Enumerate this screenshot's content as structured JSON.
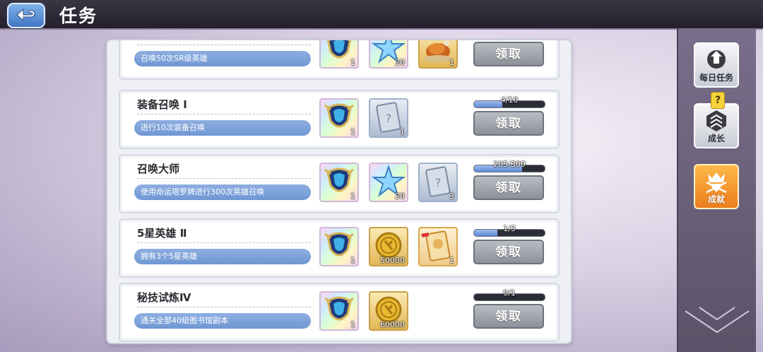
{
  "header": {
    "title": "任务"
  },
  "side_nav": [
    {
      "label": "每日任务",
      "icon": "daily-task-icon",
      "active": false
    },
    {
      "label": "成长",
      "icon": "growth-icon",
      "active": false,
      "badge": "?"
    },
    {
      "label": "成就",
      "icon": "achievement-icon",
      "active": true
    }
  ],
  "tasks": [
    {
      "name": "",
      "description": "召唤50次SR级英雄",
      "progress_text": "",
      "progress": null,
      "rewards": [
        {
          "icon": "hero-crest-icon",
          "count": "1"
        },
        {
          "icon": "summon-star-icon",
          "count": "20"
        },
        {
          "icon": "roast-chicken-icon",
          "count": "1"
        }
      ],
      "button": "领取"
    },
    {
      "name": "装备召唤 Ⅰ",
      "description": "进行10次装备召唤",
      "progress_text": "4/10",
      "progress": 0.4,
      "rewards": [
        {
          "icon": "hero-crest-icon",
          "count": "1"
        },
        {
          "icon": "mystery-card-icon",
          "count": "1"
        }
      ],
      "button": "领取"
    },
    {
      "name": "召唤大师",
      "description": "使用命运塔罗牌进行300次英雄召唤",
      "progress_text": "205/300",
      "progress": 0.683,
      "rewards": [
        {
          "icon": "hero-crest-icon",
          "count": "1"
        },
        {
          "icon": "summon-star-icon",
          "count": "20"
        },
        {
          "icon": "mystery-card-icon",
          "count": "3"
        }
      ],
      "button": "领取"
    },
    {
      "name": "5星英雄 Ⅱ",
      "description": "拥有3个5星英雄",
      "progress_text": "1/3",
      "progress": 0.333,
      "rewards": [
        {
          "icon": "hero-crest-icon",
          "count": "1"
        },
        {
          "icon": "gold-coin-icon",
          "count": "50000"
        },
        {
          "icon": "hero-card-icon",
          "count": "1"
        }
      ],
      "button": "领取"
    },
    {
      "name": "秘技试炼Ⅳ",
      "description": "通关全部40级图书馆副本",
      "progress_text": "0/1",
      "progress": 0,
      "rewards": [
        {
          "icon": "hero-crest-icon",
          "count": "1"
        },
        {
          "icon": "gold-coin-icon",
          "count": "60000"
        }
      ],
      "button": "领取"
    }
  ]
}
